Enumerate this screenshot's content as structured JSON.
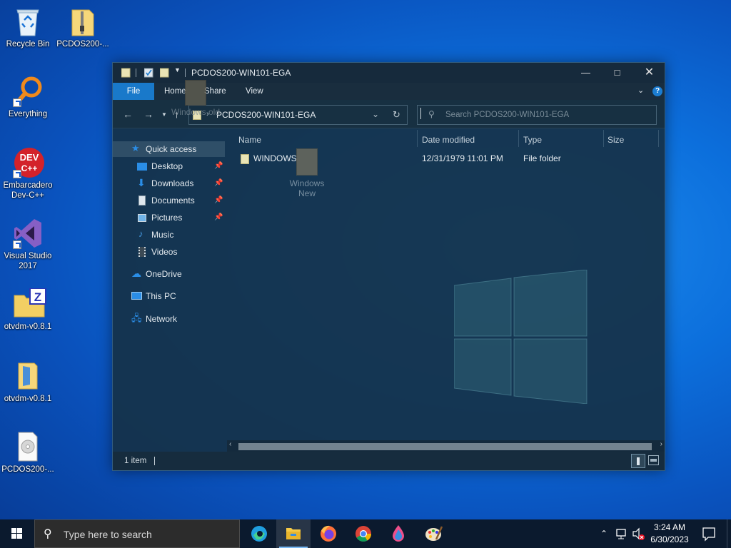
{
  "desktop": {
    "icons": [
      {
        "label": "Recycle Bin"
      },
      {
        "label": "PCDOS200-..."
      },
      {
        "label": "Everything"
      },
      {
        "label": "Embarcadero Dev-C++"
      },
      {
        "label": "Visual Studio 2017"
      },
      {
        "label": "otvdm-v0.8.1"
      },
      {
        "label": "otvdm-v0.8.1"
      },
      {
        "label": "PCDOS200-..."
      }
    ]
  },
  "explorer": {
    "title": "PCDOS200-WIN101-EGA",
    "ribbon_tabs": {
      "file": "File",
      "home": "Home",
      "share": "Share",
      "view": "View"
    },
    "address": "PCDOS200-WIN101-EGA",
    "search_placeholder": "Search PCDOS200-WIN101-EGA",
    "nav": {
      "quick_access": "Quick access",
      "desktop": "Desktop",
      "downloads": "Downloads",
      "documents": "Documents",
      "pictures": "Pictures",
      "music": "Music",
      "videos": "Videos",
      "onedrive": "OneDrive",
      "this_pc": "This PC",
      "network": "Network"
    },
    "columns": {
      "name": "Name",
      "date": "Date modified",
      "type": "Type",
      "size": "Size"
    },
    "files": [
      {
        "name": "WINDOWS",
        "date": "12/31/1979 11:01 PM",
        "type": "File folder",
        "size": ""
      }
    ],
    "drag_ghosts": {
      "old": "Windows old",
      "new_line1": "Windows",
      "new_line2": "New"
    },
    "status": "1 item"
  },
  "taskbar": {
    "search_placeholder": "Type here to search",
    "time": "3:24 AM",
    "date": "6/30/2023"
  },
  "colors": {
    "accent": "#1979ca",
    "taskbar": "#0b1a2e"
  }
}
